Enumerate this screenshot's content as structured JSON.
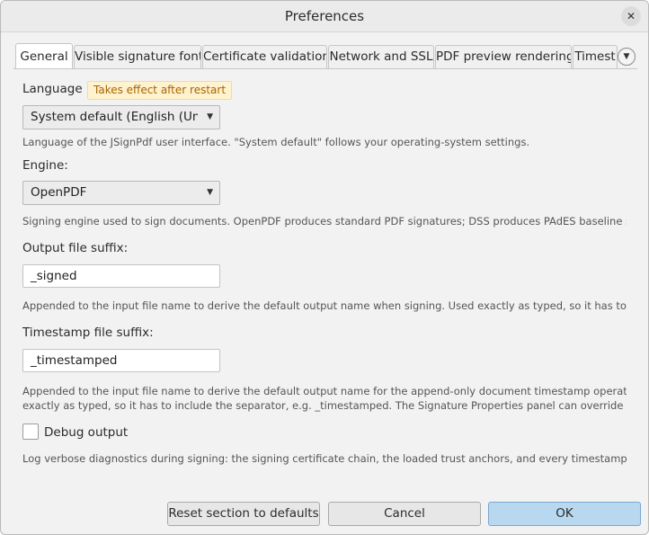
{
  "window": {
    "title": "Preferences",
    "close_glyph": "✕"
  },
  "tabs": [
    {
      "label": "General",
      "active": true
    },
    {
      "label": "Visible signature font"
    },
    {
      "label": "Certificate validation"
    },
    {
      "label": "Network and SSL"
    },
    {
      "label": "PDF preview rendering"
    },
    {
      "label": "Timest"
    }
  ],
  "tab_overflow_glyph": "▼",
  "general": {
    "language": {
      "label": "Language",
      "badge": "Takes effect after restart",
      "value": "System default (English (Unite...",
      "description": "Language of the JSignPdf user interface. \"System default\" follows your operating-system settings."
    },
    "engine": {
      "label": "Engine:",
      "value": "OpenPDF",
      "description": "Signing engine used to sign documents. OpenPDF produces standard PDF signatures; DSS produces PAdES baseline signatures ..."
    },
    "output_suffix": {
      "label": "Output file suffix:",
      "value": "_signed",
      "description": "Appended to the input file name to derive the default output name when signing. Used exactly as typed, so it has to include the ..."
    },
    "timestamp_suffix": {
      "label": "Timestamp file suffix:",
      "value": "_timestamped",
      "description_line1": "Appended to the input file name to derive the default output name for the append-only document timestamp operation. Used",
      "description_line2": "exactly as typed, so it has to include the separator, e.g. _timestamped. The Signature Properties panel can override it for the ..."
    },
    "debug": {
      "label": "Debug output",
      "checked": false,
      "description": "Log verbose diagnostics during signing: the signing certificate chain, the loaded trust anchors, and every timestamp / AIA / CRL /..."
    }
  },
  "combo_caret": "▼",
  "buttons": {
    "reset": "Reset section to defaults",
    "cancel": "Cancel",
    "ok": "OK"
  },
  "colors": {
    "accent": "#b8d8f0",
    "badge_bg": "#fff2cf",
    "badge_text": "#a76400"
  }
}
